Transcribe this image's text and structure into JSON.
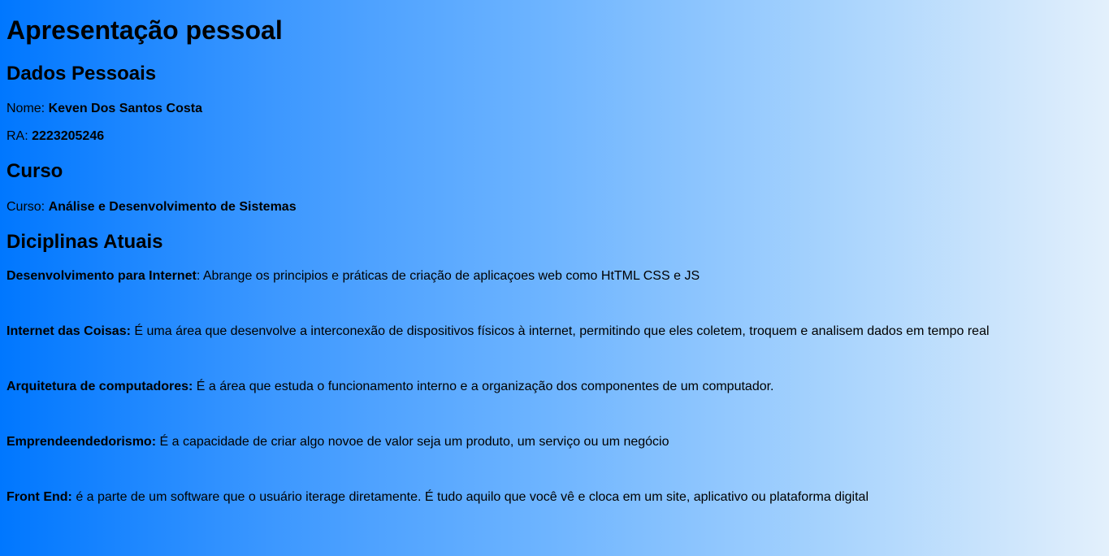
{
  "title": "Apresentação pessoal",
  "dados": {
    "heading": "Dados Pessoais",
    "nome_label": "Nome: ",
    "nome_value": "Keven Dos Santos Costa",
    "ra_label": "RA: ",
    "ra_value": "2223205246"
  },
  "curso": {
    "heading": "Curso",
    "label": "Curso: ",
    "value": "Análise e Desenvolvimento de Sistemas"
  },
  "disciplinas": {
    "heading": "Diciplinas Atuais",
    "items": [
      {
        "name": "Desenvolvimento para Internet",
        "description": ": Abrange os principios e práticas de criação de aplicaçoes web como HtTML CSS e JS"
      },
      {
        "name": "Internet das Coisas:",
        "description": " É uma área que desenvolve a interconexão de dispositivos físicos à internet, permitindo que eles coletem, troquem e analisem dados em tempo real"
      },
      {
        "name": "Arquitetura de computadores:",
        "description": " É a área que estuda o funcionamento interno e a organização dos componentes de um computador."
      },
      {
        "name": "Emprendeendedorismo:",
        "description": " É a capacidade de criar algo novoe de valor seja um produto, um serviço ou um negócio"
      },
      {
        "name": "Front End:",
        "description": " é a parte de um software que o usuário iterage diretamente. É tudo aquilo que você vê e cloca em um site, aplicativo ou plataforma digital"
      }
    ]
  }
}
